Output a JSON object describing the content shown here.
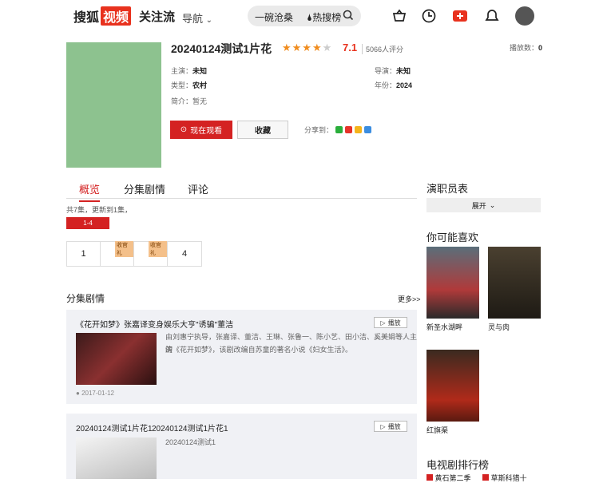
{
  "header": {
    "logo_left": "搜狐",
    "logo_box": "视频",
    "logo_right": "关注流",
    "nav_label": "导航",
    "search_query": "一碗沧桑",
    "hot_label": "热搜榜"
  },
  "detail": {
    "title": "20240124测试1片花",
    "stars": "★★★★",
    "half_star": "★",
    "score": "7.1",
    "rating_count": "5066人评分",
    "play_label": "播放数：",
    "play_count": "0",
    "actor_label": "主演：",
    "actor_value": "未知",
    "director_label": "导演：",
    "director_value": "未知",
    "type_label": "类型：",
    "type_value": "农村",
    "year_label": "年份：",
    "year_value": "2024",
    "intro_label": "简介：",
    "intro_value": "暂无",
    "watch_button": "现在观看",
    "fav_button": "收藏",
    "share_label": "分享到："
  },
  "tabs": [
    "概览",
    "分集剧情",
    "评论"
  ],
  "episodes": {
    "info": "共7集，更新到1集，",
    "range": "1-4",
    "cells": [
      "1",
      "2",
      "3",
      "4"
    ],
    "tag": "收官礼"
  },
  "plot_section": {
    "title": "分集剧情",
    "more": "更多>>",
    "cards": [
      {
        "title": "《花开如梦》张嘉译变身娱乐大亨\"诱骗\"董洁",
        "play": "播放",
        "desc1": "由刘惠宁执导，张嘉译、董洁、王琳、张鲁一、陈小艺、田小洁、奚美娟等人主演",
        "desc2": "的《花开如梦》，该剧改编自苏童的著名小说《妇女生活》。",
        "date": "2017-01-12"
      },
      {
        "title": "20240124测试1片花1",
        "title2": "20240124测试1片花1",
        "play": "播放",
        "desc1": "20240124测试1"
      }
    ]
  },
  "right": {
    "cast_title": "演职员表",
    "expand": "展开",
    "like_title": "你可能喜欢",
    "recs": [
      {
        "name": "新圣水湖畔"
      },
      {
        "name": "灵与肉"
      },
      {
        "name": "红旗渠"
      }
    ],
    "rank_title": "电视剧排行榜",
    "rank_items": [
      "黄石第二季",
      "草斯科猎十"
    ]
  },
  "colors": {
    "accent": "#d42222",
    "star": "#f08c1e"
  }
}
